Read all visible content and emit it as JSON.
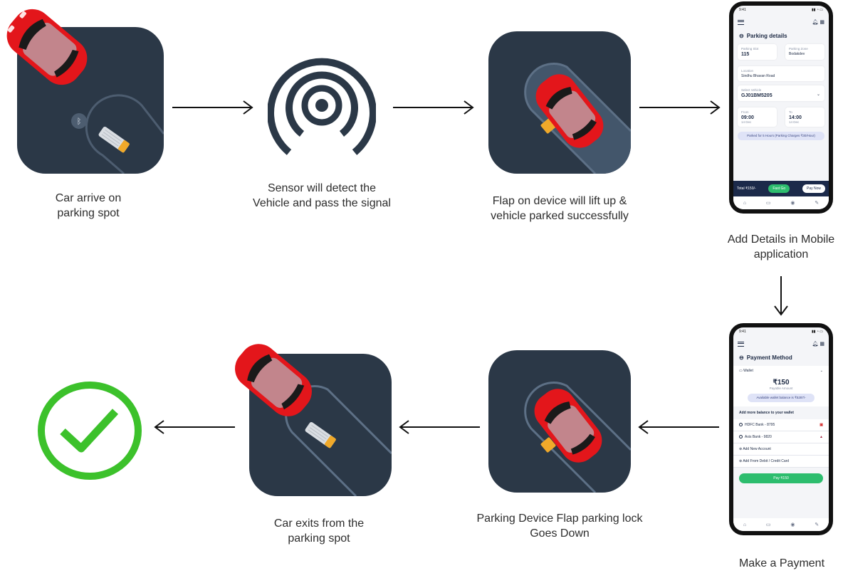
{
  "steps": {
    "car_arrive": [
      "Car arrive on",
      "parking spot"
    ],
    "sensor": [
      "Sensor will detect the",
      "Vehicle and pass the signal"
    ],
    "flap_up": [
      "Flap on device will lift up &",
      "vehicle parked successfully"
    ],
    "add_details": [
      "Add Details in Mobile",
      "application"
    ],
    "payment": [
      "Make a Payment"
    ],
    "flap_down": [
      "Parking Device Flap parking lock",
      "Goes Down"
    ],
    "car_exits": [
      "Car exits from the",
      "parking spot"
    ]
  },
  "phone1": {
    "time": "9:41",
    "title": "Parking details",
    "parking_slot_label": "Parking Slot",
    "parking_slot": "115",
    "parking_zone_label": "Parking Zone",
    "parking_zone": "Bodakdev",
    "location_label": "Location",
    "location": "Sindhu Bhavan Road",
    "vehicle_label": "Select Vehicle",
    "vehicle": "GJ01BM5205",
    "from_label": "From",
    "from_time": "09:00",
    "from_date": "14 Dec",
    "to_label": "To",
    "to_time": "14:00",
    "to_date": "14 Dec",
    "note": "Parked for 5 Hours (Parking Charges ₹30/Hour)",
    "total": "Total ₹150/-",
    "fast_go": "Fast Go",
    "pay_now": "Pay Now"
  },
  "phone2": {
    "time": "9:41",
    "title": "Payment Method",
    "wallet": "Wallet",
    "amount": "₹150",
    "amount_label": "Payable Amount",
    "balance": "Available wallet balance is ₹5287/-",
    "add_more": "Add more balance to your wallet",
    "bank1": "HDFC Bank - 8795",
    "bank2": "Axis Bank - 9820",
    "add_account": "Add New Account",
    "add_card": "Add From Debit / Credit Card",
    "pay_button": "Pay ₹150"
  },
  "colors": {
    "tile": "#2b3847",
    "car": "#e3161b",
    "flap": "#f0a92a",
    "check": "#3cc12b"
  }
}
